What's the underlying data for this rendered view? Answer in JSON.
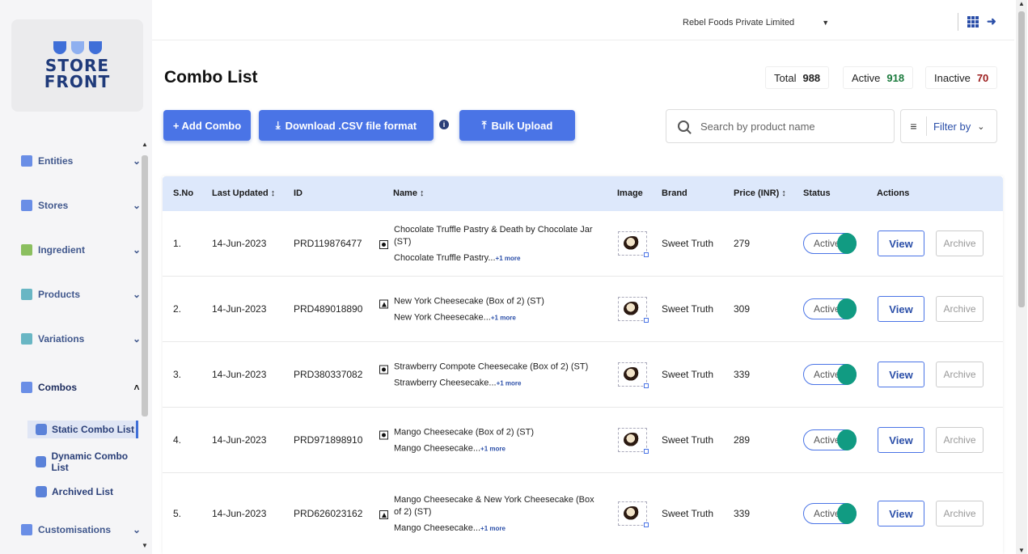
{
  "brand": {
    "logo_text_line1": "STORE",
    "logo_text_line2": "FRONT"
  },
  "topbar": {
    "company": "Rebel Foods Private Limited"
  },
  "sidebar": {
    "items": [
      {
        "label": "Entities",
        "icon": "entities-icon",
        "chevron": "v"
      },
      {
        "label": "Stores",
        "icon": "stores-icon",
        "chevron": "v"
      },
      {
        "label": "Ingredient",
        "icon": "ingredient-icon",
        "chevron": "v"
      },
      {
        "label": "Products",
        "icon": "products-icon",
        "chevron": "v"
      },
      {
        "label": "Variations",
        "icon": "variations-icon",
        "chevron": "v"
      },
      {
        "label": "Combos",
        "icon": "combos-icon",
        "chevron": "^"
      },
      {
        "label": "Customisations",
        "icon": "customisations-icon",
        "chevron": "v"
      }
    ],
    "sub_items": [
      {
        "label": "Static Combo List",
        "active": true
      },
      {
        "label": "Dynamic Combo List",
        "active": false
      },
      {
        "label": "Archived List",
        "active": false
      }
    ]
  },
  "page": {
    "title": "Combo List",
    "stats": [
      {
        "label": "Total",
        "value": "988",
        "color": "#222222"
      },
      {
        "label": "Active",
        "value": "918",
        "color": "#1a7a3c"
      },
      {
        "label": "Inactive",
        "value": "70",
        "color": "#9b1c1c"
      }
    ],
    "buttons": {
      "add": "+ Add Combo",
      "download": "Download .CSV file format",
      "bulk": "Bulk Upload"
    },
    "search": {
      "placeholder": "Search by product name"
    },
    "filter": {
      "label": "Filter by"
    }
  },
  "table": {
    "headers": {
      "sno": "S.No",
      "updated": "Last Updated",
      "id": "ID",
      "name": "Name",
      "image": "Image",
      "brand": "Brand",
      "price": "Price (INR)",
      "status": "Status",
      "actions": "Actions"
    },
    "rows": [
      {
        "sno": "1.",
        "updated": "14-Jun-2023",
        "id": "PRD119876477",
        "name": "Chocolate Truffle Pastry & Death by Chocolate Jar (ST)",
        "sub": "Chocolate Truffle Pastry...",
        "more": "+1 more",
        "type": "veg",
        "brand": "Sweet Truth",
        "price": "279",
        "status": "Active",
        "view": "View",
        "archive": "Archive"
      },
      {
        "sno": "2.",
        "updated": "14-Jun-2023",
        "id": "PRD489018890",
        "name": "New York Cheesecake (Box of 2) (ST)",
        "sub": "New York Cheesecake...",
        "more": "+1 more",
        "type": "egg",
        "brand": "Sweet Truth",
        "price": "309",
        "status": "Active",
        "view": "View",
        "archive": "Archive"
      },
      {
        "sno": "3.",
        "updated": "14-Jun-2023",
        "id": "PRD380337082",
        "name": "Strawberry Compote Cheesecake (Box of 2) (ST)",
        "sub": "Strawberry Cheesecake...",
        "more": "+1 more",
        "type": "veg",
        "brand": "Sweet Truth",
        "price": "339",
        "status": "Active",
        "view": "View",
        "archive": "Archive"
      },
      {
        "sno": "4.",
        "updated": "14-Jun-2023",
        "id": "PRD971898910",
        "name": "Mango Cheesecake (Box of 2) (ST)",
        "sub": "Mango Cheesecake...",
        "more": "+1 more",
        "type": "veg",
        "brand": "Sweet Truth",
        "price": "289",
        "status": "Active",
        "view": "View",
        "archive": "Archive"
      },
      {
        "sno": "5.",
        "updated": "14-Jun-2023",
        "id": "PRD626023162",
        "name": "Mango Cheesecake & New York Cheesecake (Box of 2) (ST)",
        "sub": "Mango Cheesecake...",
        "more": "+1 more",
        "type": "egg",
        "brand": "Sweet Truth",
        "price": "339",
        "status": "Active",
        "view": "View",
        "archive": "Archive"
      }
    ]
  },
  "colors": {
    "primary": "#4a74e6",
    "toggle_on": "#119b82",
    "header_bg": "#dde8fb"
  }
}
